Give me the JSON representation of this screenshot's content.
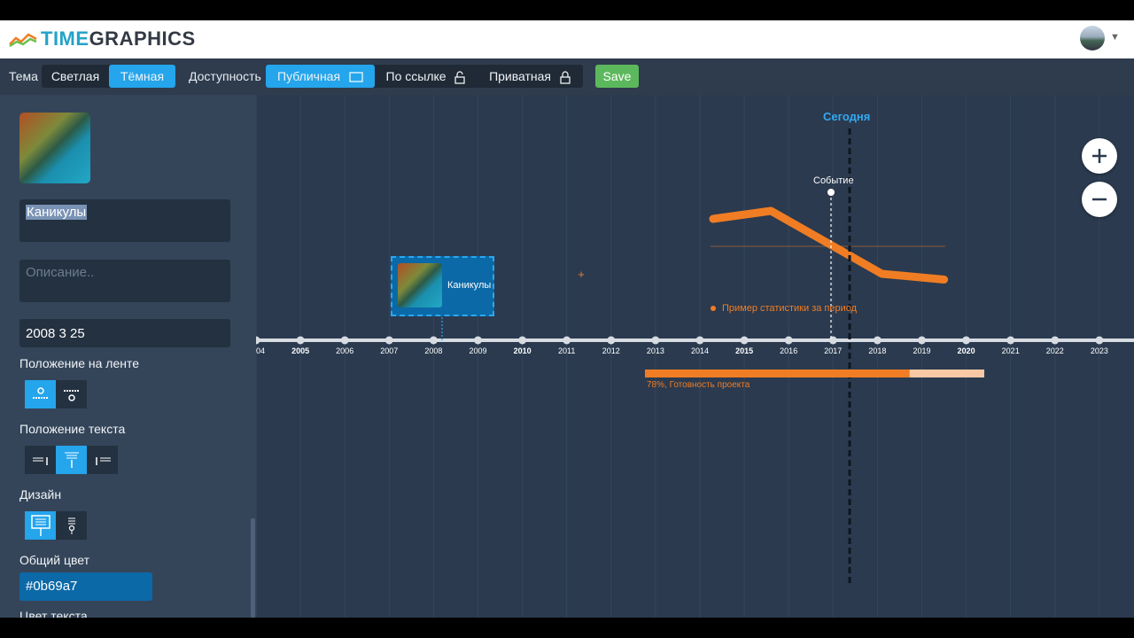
{
  "header": {
    "logo_time": "TIME",
    "logo_graphics": "GRAPHICS"
  },
  "toolbar": {
    "theme_label": "Тема",
    "theme_options": [
      "Светлая",
      "Тёмная"
    ],
    "theme_selected": "Тёмная",
    "access_label": "Доступность",
    "access_options": [
      "Публичная",
      "По ссылке",
      "Приватная"
    ],
    "access_selected": "Публичная",
    "save_label": "Save"
  },
  "sidebar": {
    "title_value": "Каникулы",
    "description_placeholder": "Описание..",
    "date_value": "2008 3 25",
    "position_label": "Положение на ленте",
    "text_position_label": "Положение текста",
    "design_label": "Дизайн",
    "color_label": "Общий цвет",
    "color_value": "#0b69a7",
    "text_color_label": "Цвет текста"
  },
  "timeline": {
    "years": [
      "04",
      "2005",
      "2006",
      "2007",
      "2008",
      "2009",
      "2010",
      "2011",
      "2012",
      "2013",
      "2014",
      "2015",
      "2016",
      "2017",
      "2018",
      "2019",
      "2020",
      "2021",
      "2022",
      "2023"
    ],
    "bold_years": [
      "2005",
      "2010",
      "2015",
      "2020"
    ],
    "today_label": "Сегодня",
    "event_label": "Событие",
    "event_card_title": "Каникулы",
    "stat_label": "Пример статистики за период",
    "progress_label": "78%, Готовность проекта",
    "progress_value": 0.78,
    "stat_points": [
      [
        2014.3,
        0.62
      ],
      [
        2015.6,
        0.8
      ],
      [
        2018.1,
        -0.62
      ],
      [
        2019.5,
        -0.75
      ]
    ],
    "colors": {
      "accent": "#24a5ec",
      "orange": "#f07d23",
      "progress_rest": "#f8c9a4",
      "canvas": "#2b3a4f"
    }
  }
}
